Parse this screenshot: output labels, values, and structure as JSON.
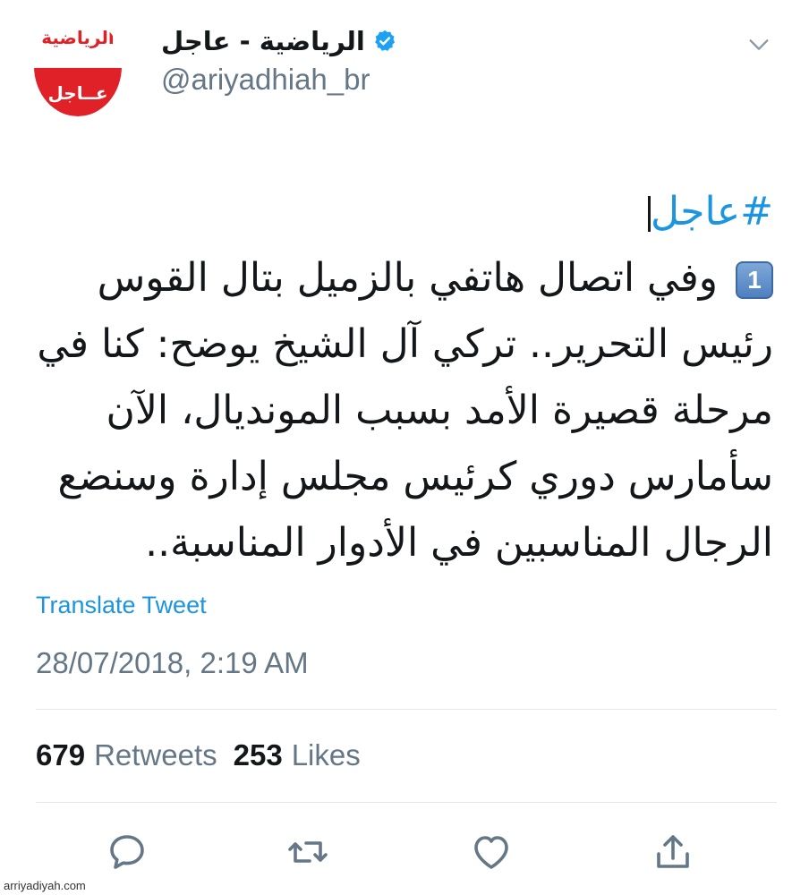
{
  "header": {
    "avatar_logo_text": "الرياضية",
    "avatar_sub_text": "عــاجل",
    "display_name": "الرياضية - عاجل",
    "handle": "@ariyadhiah_br"
  },
  "tweet": {
    "hashtag": "#عاجل",
    "keycap": "1",
    "body": "وفي اتصال هاتفي بالزميل بتال القوس رئيس التحرير.. تركي آل الشيخ يوضح: كنا في مرحلة قصيرة الأمد بسبب المونديال، الآن سأمارس دوري كرئيس مجلس إدارة وسنضع الرجال المناسبين في الأدوار المناسبة.."
  },
  "translate_label": "Translate Tweet",
  "timestamp": "28/07/2018, 2:19 AM",
  "stats": {
    "retweets_count": "679",
    "retweets_label": "Retweets",
    "likes_count": "253",
    "likes_label": "Likes"
  },
  "actions": [
    "reply-icon",
    "retweet-icon",
    "like-icon",
    "share-icon"
  ],
  "watermark": "arriyadiyah.com",
  "colors": {
    "accent": "#1b95e0",
    "secondary_text": "#657786",
    "primary_text": "#14171a",
    "divider": "#e1e8ed",
    "brand_red": "#e02127"
  }
}
